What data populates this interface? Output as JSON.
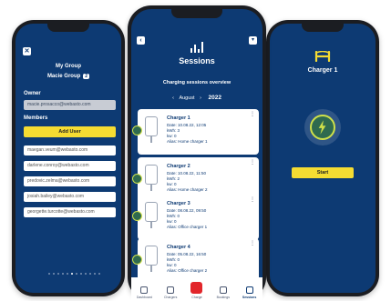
{
  "left": {
    "title": "My Group",
    "group_name": "Macie Group",
    "group_badge": "2",
    "owner_label": "Owner",
    "owner_email": "macie.prosacco@webasto.com",
    "members_label": "Members",
    "add_user_label": "Add User",
    "members": [
      "maegan.veum@webasto.com",
      "darlene.conroy@webasto.com",
      "predovic.zelma@webasto.com",
      "josiah.bailey@webasto.com",
      "georgette.turcotte@webasto.com"
    ]
  },
  "center": {
    "title": "Sessions",
    "subtitle": "Charging sessions overview",
    "month": "August",
    "year": "2022",
    "prev_arrow": "‹",
    "next_arrow": "›",
    "sessions": [
      {
        "name": "Charger 1",
        "date": "Date: 10.08.22, 12:05",
        "kwh": "kWh: 3",
        "kw": "kw: 0",
        "alias": "Alias: Home charger 1"
      },
      {
        "name": "Charger 2",
        "date": "Date: 10.08.22, 11:50",
        "kwh": "kWh: 2",
        "kw": "kw: 0",
        "alias": "Alias: Home charger 2"
      },
      {
        "name": "Charger 3",
        "date": "Date: 08.08.22, 09:50",
        "kwh": "kWh: 0",
        "kw": "kw: 0",
        "alias": "Alias: Office charger 1"
      },
      {
        "name": "Charger 4",
        "date": "Date: 05.08.22, 16:50",
        "kwh": "kWh: 0",
        "kw": "kw: 0",
        "alias": "Alias: Office charger 2"
      }
    ],
    "tabs": [
      {
        "label": "Dashboard",
        "icon": "dashboard-icon"
      },
      {
        "label": "Chargers",
        "icon": "plug-icon"
      },
      {
        "label": "Charge",
        "icon": "bolt-icon"
      },
      {
        "label": "Bookings",
        "icon": "calendar-icon"
      },
      {
        "label": "Sessions",
        "icon": "bar-chart-icon"
      }
    ]
  },
  "right": {
    "title": "Charger 1",
    "start_label": "Start"
  },
  "colors": {
    "screen_bg": "#0d3a73",
    "accent": "#f5dc32",
    "charge_tab": "#e2262b",
    "bolt_ring": "#cfe04a"
  }
}
